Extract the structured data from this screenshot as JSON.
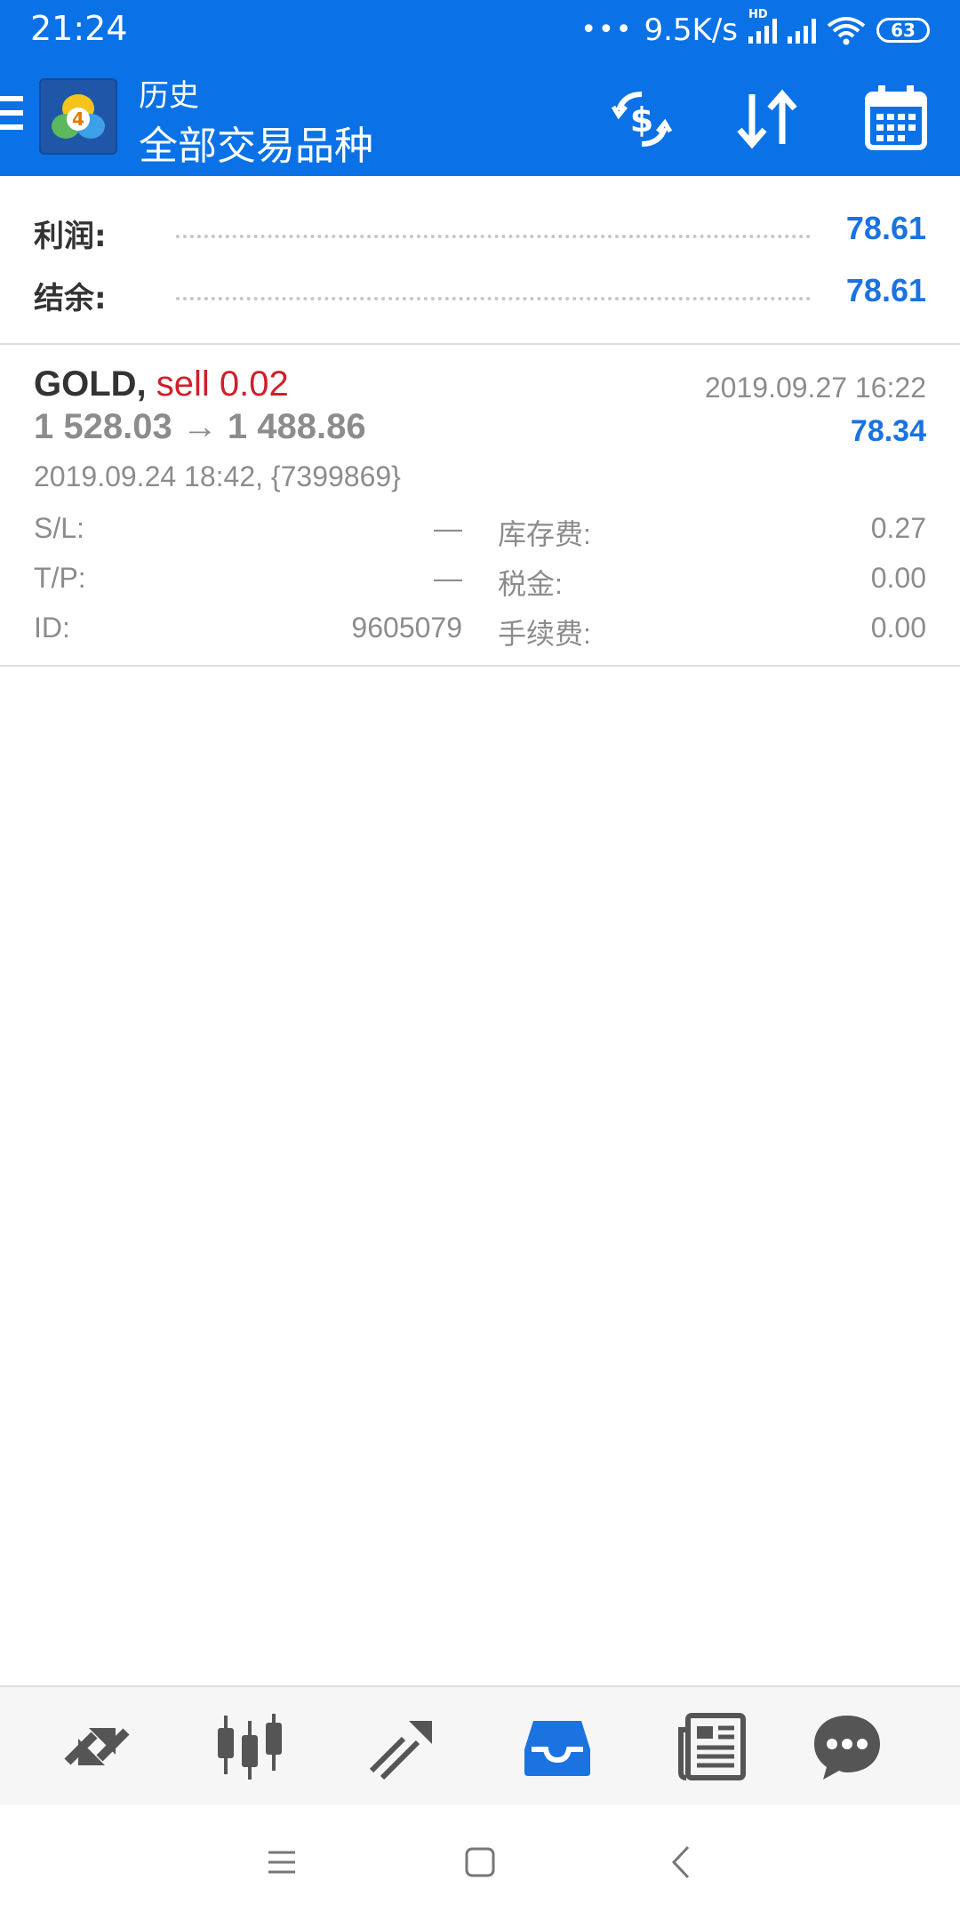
{
  "status_bar": {
    "time": "21:24",
    "dots": "•••",
    "network_speed": "9.5K/s",
    "signal_badge": "HD",
    "battery": "63"
  },
  "header": {
    "subtitle": "历史",
    "title": "全部交易品种",
    "icons": [
      "menu-icon",
      "metatrader-logo",
      "currency-exchange-icon",
      "sort-icon",
      "calendar-icon"
    ]
  },
  "summary": {
    "profit_label": "利润:",
    "profit_value": "78.61",
    "balance_label": "结余:",
    "balance_value": "78.61"
  },
  "deal": {
    "symbol": "GOLD,",
    "type": "sell 0.02",
    "close_time": "2019.09.27 16:22",
    "prices": "1 528.03 → 1 488.86",
    "profit": "78.34",
    "open_info": "2019.09.24 18:42, {7399869}",
    "sl_label": "S/L:",
    "sl_value": "—",
    "tp_label": "T/P:",
    "tp_value": "—",
    "id_label": "ID:",
    "id_value": "9605079",
    "swap_label": "库存费:",
    "swap_value": "0.27",
    "tax_label": "税金:",
    "tax_value": "0.00",
    "commission_label": "手续费:",
    "commission_value": "0.00"
  },
  "bottom_nav": {
    "items": [
      "quotes-icon",
      "chart-icon",
      "trade-icon",
      "history-icon",
      "news-icon",
      "chat-icon"
    ],
    "active": "history-icon"
  },
  "colors": {
    "appbar": "#0a72e6",
    "accent_blue": "#1a73e0",
    "sell_red": "#d01f2a",
    "text_gray": "#8c8c8c"
  }
}
